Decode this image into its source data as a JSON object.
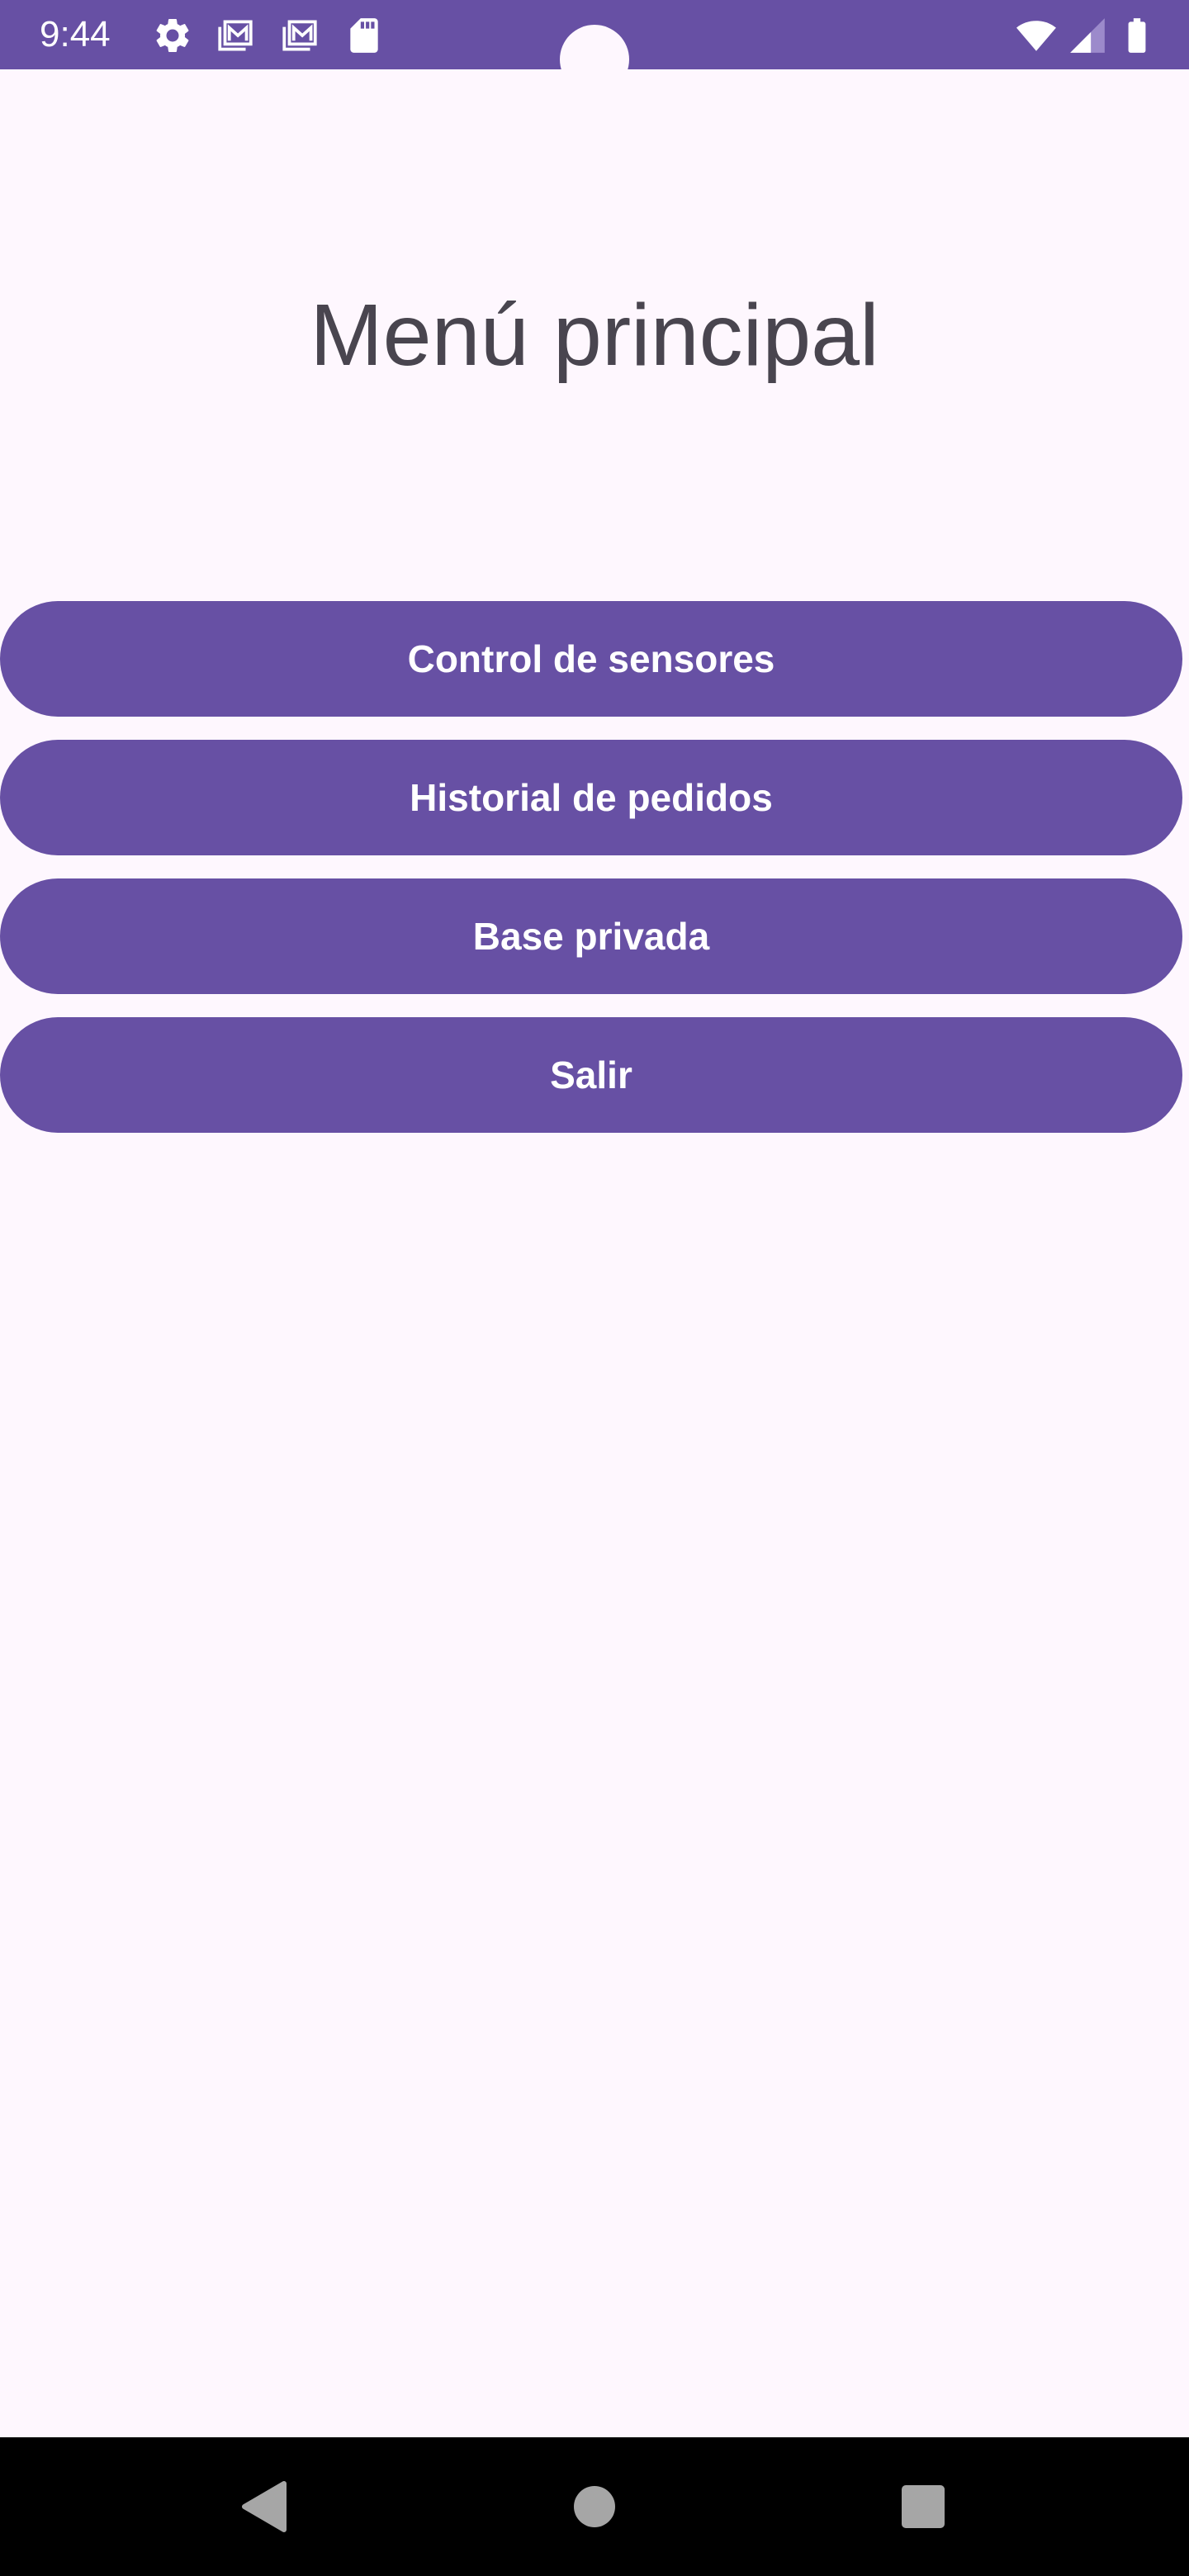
{
  "status_bar": {
    "time": "9:44",
    "icons": [
      "settings-icon",
      "gmail-icon",
      "gmail-icon",
      "sd-card-icon",
      "wifi-icon",
      "signal-icon",
      "battery-icon"
    ]
  },
  "main": {
    "title": "Menú principal",
    "buttons": [
      {
        "label": "Control de sensores"
      },
      {
        "label": "Historial de pedidos"
      },
      {
        "label": "Base privada"
      },
      {
        "label": "Salir"
      }
    ]
  },
  "navigation": {
    "icons": [
      "back-icon",
      "home-icon",
      "recents-icon"
    ]
  },
  "colors": {
    "primary": "#6750A4",
    "background": "#FEF7FE",
    "title_text": "#49454F",
    "button_text": "#FFFFFF",
    "nav_bar": "#000000"
  }
}
